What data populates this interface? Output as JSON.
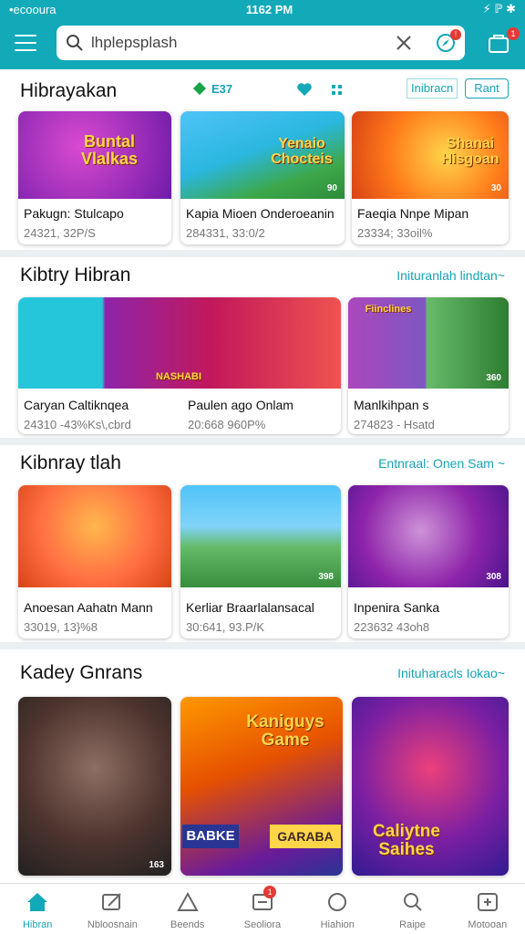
{
  "status": {
    "left": "•ecooura",
    "time": "1162 PM",
    "right": "⚡ ℙ ✱"
  },
  "search": {
    "value": "lhplepsplash"
  },
  "badges": {
    "notif": "!",
    "cart": "1",
    "nav_shortcut": "1"
  },
  "sections": [
    {
      "title": "Hibrayakan",
      "stat": "E37",
      "chip1": "Inibracn",
      "chip2": "Rant",
      "cards": [
        {
          "thumb": "Buntal Vlalkas",
          "tag": "",
          "t1": "Pakugn: Stulcapo",
          "t2": "24321, 32P/S"
        },
        {
          "thumb": "Yenaio Chocteis",
          "tag": "90",
          "t1": "Kapia Mioen Onderoeanin",
          "t2": "284331, 33:0/2"
        },
        {
          "thumb": "Shanai Hisgoan",
          "tag": "30",
          "t1": "Faeqia Nnpe Mipan",
          "t2": "23334; 33oil%"
        }
      ]
    },
    {
      "title": "Kibtry Hibran",
      "link": "Inituranlah lindtan~",
      "cards": [
        {
          "thumb": "",
          "tag": "",
          "t1": "Caryan Caltiknqea",
          "t2": "24310 -43%Ks\\,cbrd"
        },
        {
          "thumb": "NASHABI",
          "tag": "",
          "t1": "Paulen ago Onlam",
          "t2": "20:668 960P%"
        },
        {
          "thumb": "Fiinclines",
          "tag": "360",
          "t1": "Manlkihpan s",
          "t2": "274823 - Hsatd"
        }
      ]
    },
    {
      "title": "Kibnray tlah",
      "link": "Entnraal: Onen Sam ~",
      "cards": [
        {
          "thumb": "",
          "tag": "",
          "t1": "Anoesan Aahatn Mann",
          "t2": "33019, 13}%8"
        },
        {
          "thumb": "",
          "tag": "398",
          "t1": "Kerliar Braarlalansacal",
          "t2": "30:641, 93.P/K"
        },
        {
          "thumb": "",
          "tag": "308",
          "t1": "Inpenira Sanka",
          "t2": "223632 43oh8"
        }
      ]
    },
    {
      "title": "Kadey Gnrans",
      "link": "Inituharacls Iokao~",
      "cards": [
        {
          "thumb": "",
          "tag": "163",
          "t1": "",
          "t2": ""
        },
        {
          "thumb": "Kaniguys Game",
          "tag": "",
          "t1": "BABKE",
          "t2": "GARABA"
        },
        {
          "thumb": "Caliytne Saihes",
          "tag": "",
          "t1": "",
          "t2": ""
        }
      ]
    }
  ],
  "nav": [
    {
      "label": "Hibran",
      "icon": "home-icon"
    },
    {
      "label": "Nbloosnain",
      "icon": "edit-icon"
    },
    {
      "label": "Beends",
      "icon": "triangle-icon"
    },
    {
      "label": "Seoliora",
      "icon": "message-icon"
    },
    {
      "label": "Hiahion",
      "icon": "circle-icon"
    },
    {
      "label": "Raipe",
      "icon": "search-icon"
    },
    {
      "label": "Motooan",
      "icon": "console-icon"
    }
  ],
  "colors": {
    "accent": "#12a9b8",
    "badge": "#e53935"
  }
}
